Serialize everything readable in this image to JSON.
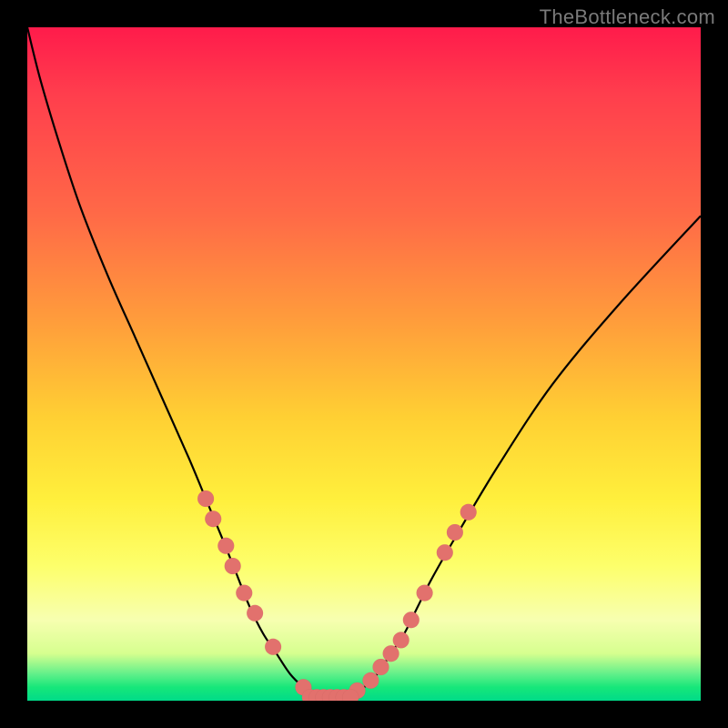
{
  "watermark": "TheBottleneck.com",
  "colors": {
    "background_frame": "#000000",
    "curve_stroke": "#000000",
    "dot_fill": "#e2716d",
    "gradient_top": "#ff1b4b",
    "gradient_mid": "#ffd033",
    "gradient_bottom": "#00db88"
  },
  "chart_data": {
    "type": "line",
    "title": "",
    "xlabel": "",
    "ylabel": "",
    "xlim": [
      0,
      100
    ],
    "ylim": [
      0,
      100
    ],
    "grid": false,
    "legend": false,
    "series": [
      {
        "name": "bottleneck-curve",
        "x": [
          0,
          2,
          5,
          8,
          12,
          16,
          20,
          24,
          26.5,
          29,
          31,
          33,
          35,
          37,
          39,
          41,
          42.5,
          44,
          46,
          48,
          50,
          52,
          54,
          56,
          58,
          60,
          64,
          70,
          78,
          88,
          100
        ],
        "y": [
          100,
          92,
          82,
          73,
          63,
          54,
          45,
          36,
          30,
          24,
          19,
          14,
          10,
          7,
          4,
          2,
          1,
          0.5,
          0.5,
          1,
          2,
          4,
          7,
          10,
          14,
          18,
          25,
          35,
          47,
          59,
          72
        ]
      }
    ],
    "points_left": [
      {
        "x": 26.5,
        "y": 30
      },
      {
        "x": 27.6,
        "y": 27
      },
      {
        "x": 29.5,
        "y": 23
      },
      {
        "x": 30.5,
        "y": 20
      },
      {
        "x": 32.2,
        "y": 16
      },
      {
        "x": 33.8,
        "y": 13
      },
      {
        "x": 36.5,
        "y": 8
      },
      {
        "x": 41.0,
        "y": 2
      }
    ],
    "points_right": [
      {
        "x": 49.0,
        "y": 1.5
      },
      {
        "x": 51.0,
        "y": 3
      },
      {
        "x": 52.5,
        "y": 5
      },
      {
        "x": 54.0,
        "y": 7
      },
      {
        "x": 55.5,
        "y": 9
      },
      {
        "x": 57.0,
        "y": 12
      },
      {
        "x": 59.0,
        "y": 16
      },
      {
        "x": 62.0,
        "y": 22
      },
      {
        "x": 63.5,
        "y": 25
      },
      {
        "x": 65.5,
        "y": 28
      }
    ],
    "flat_region": {
      "x_start": 42,
      "x_end": 48,
      "y": 0.5
    }
  }
}
